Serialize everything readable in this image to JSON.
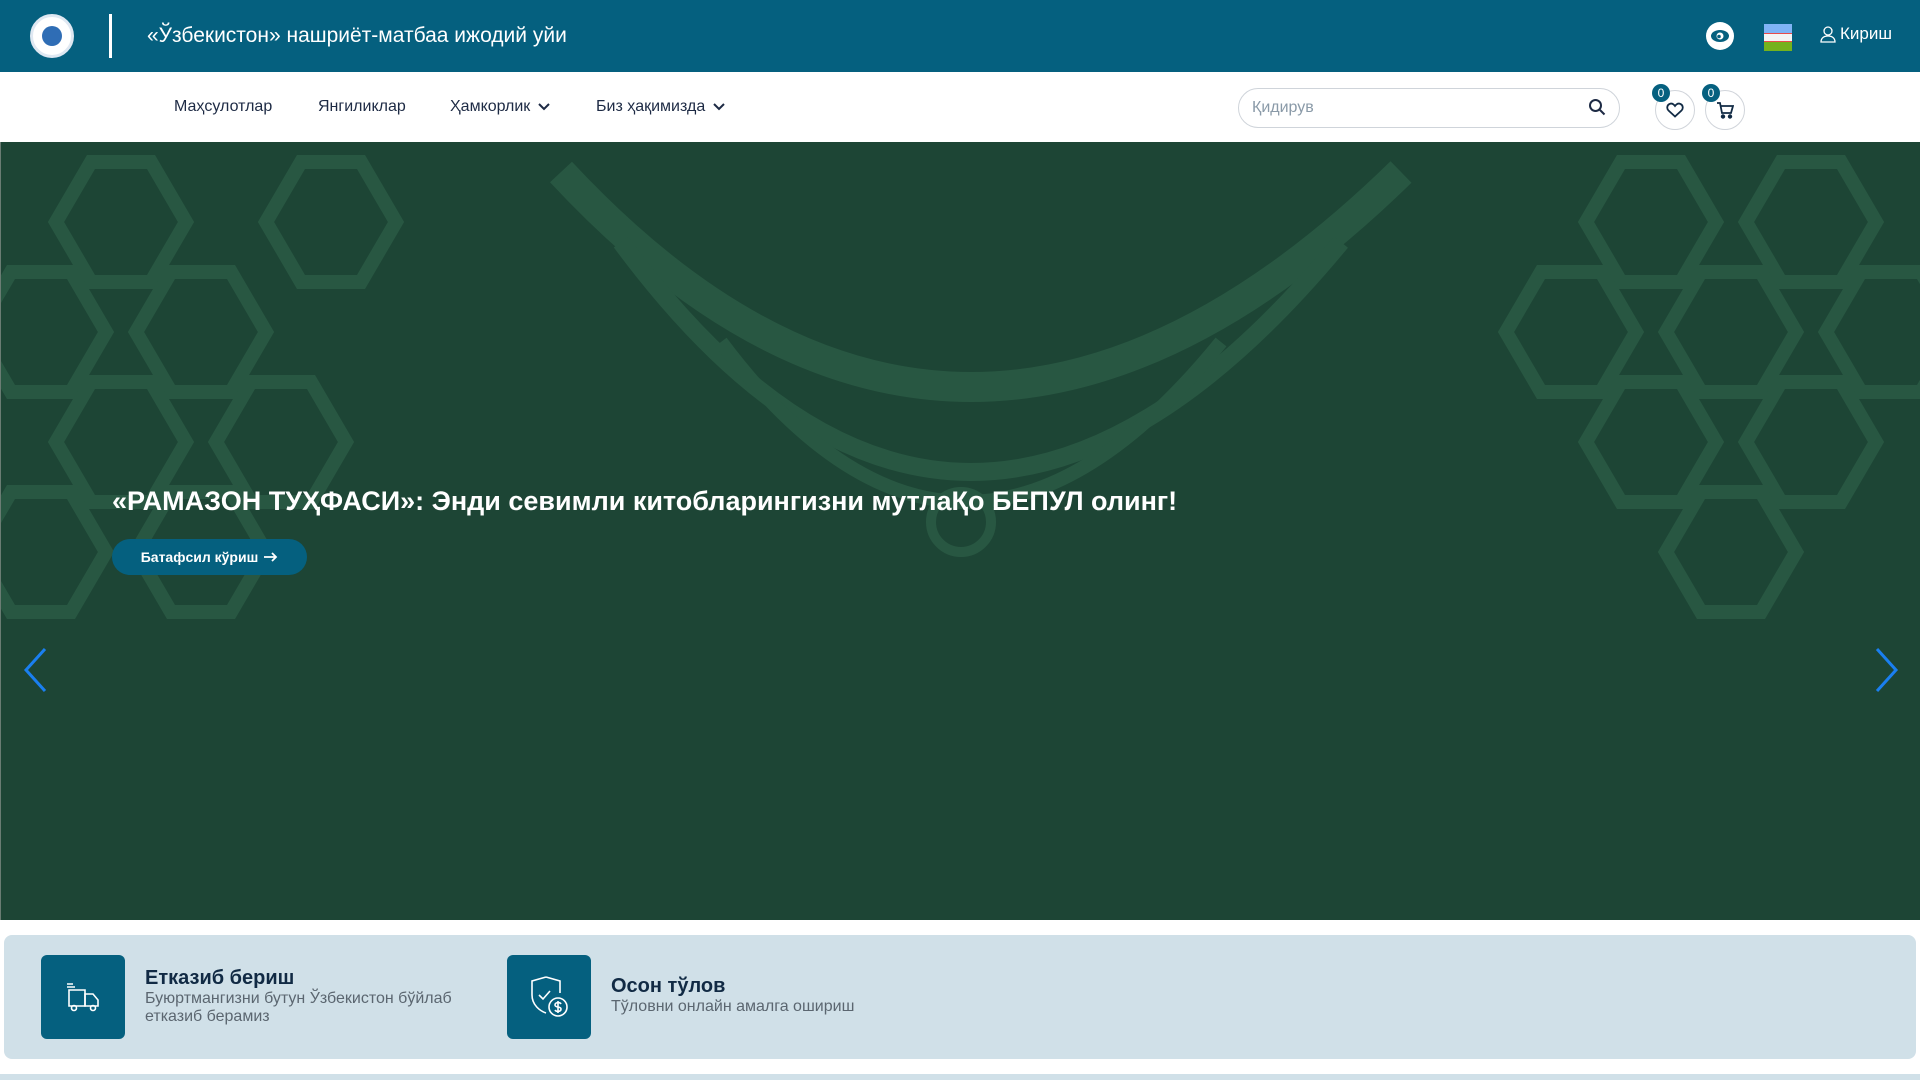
{
  "header": {
    "site_title": "«Ўзбекистон» нашриёт-матбаа ижодий уйи",
    "login_label": "Кириш",
    "flag_colors": [
      "#7fb3f5",
      "#ffffff",
      "#75b21d"
    ]
  },
  "nav": {
    "items": [
      {
        "label": "Маҳсулотлар"
      },
      {
        "label": "Янгиликлар"
      },
      {
        "label": "Ҳамкорлик"
      },
      {
        "label": "Биз ҳақимизда"
      }
    ],
    "search_placeholder": "Қидирув",
    "wishlist_count": "0",
    "cart_count": "0"
  },
  "hero": {
    "headline": "«РАМАЗОН ТУҲФАСИ»: Энди севимли китобларингизни мутлаҚо БЕПУЛ олинг!",
    "cta_label": "Батафсил кўриш",
    "background": "#1d4535"
  },
  "features": [
    {
      "title": "Етказиб бериш",
      "desc_line1": "Буюртмангизни бутун Ўзбекистон бўйлаб",
      "desc_line2": "етказиб берамиз",
      "icon": "delivery-truck-icon"
    },
    {
      "title": "Осон тўлов",
      "desc_line1": "Тўловни онлайн амалга ошириш",
      "icon": "payment-shield-icon"
    }
  ],
  "colors": {
    "primary": "#05607f",
    "hero": "#1d4535",
    "panel": "#d0e0e8"
  }
}
